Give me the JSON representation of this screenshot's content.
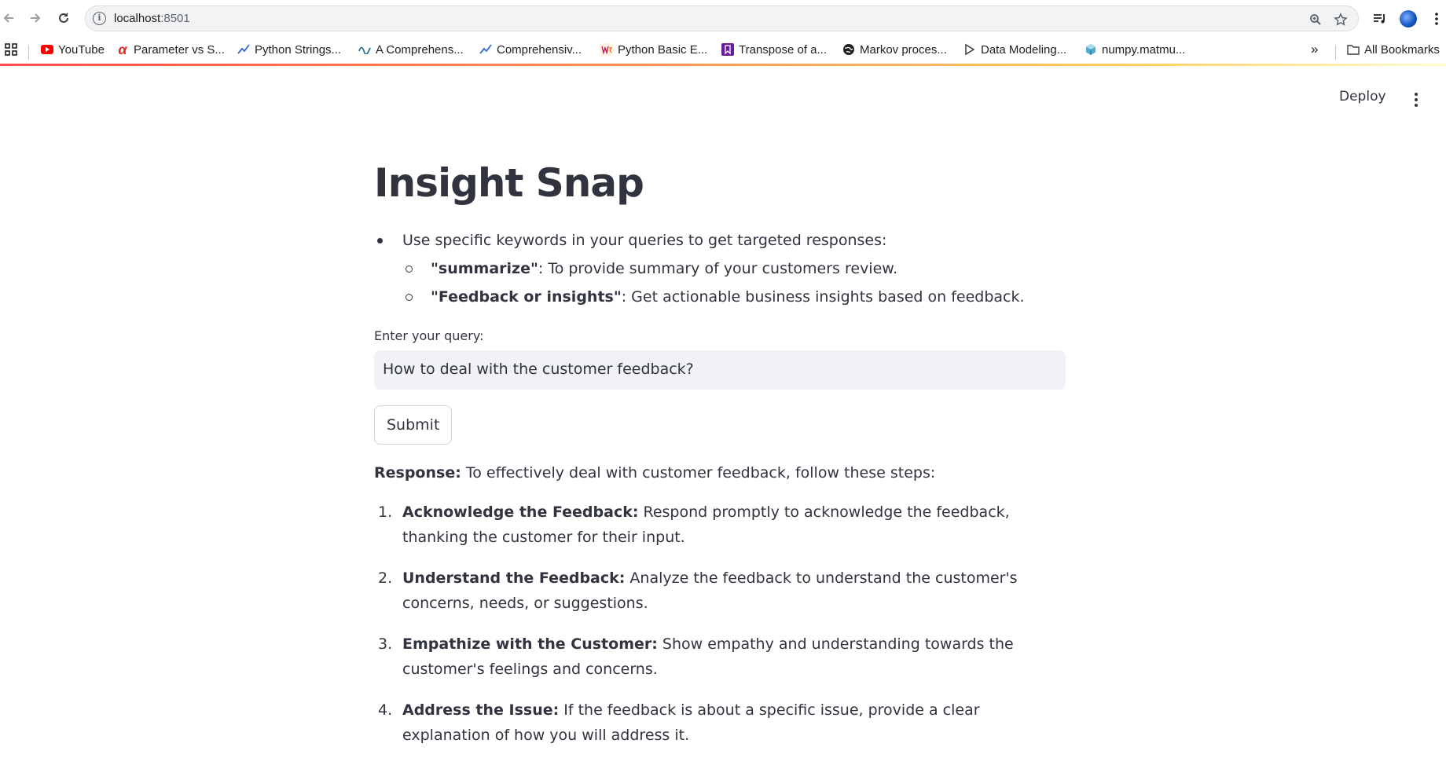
{
  "browser": {
    "url_host": "localhost",
    "url_port": ":8501",
    "bookmarks": [
      {
        "label": "YouTube",
        "icon": "youtube-icon"
      },
      {
        "label": "Parameter vs S...",
        "icon": "alpha-icon"
      },
      {
        "label": "Python Strings...",
        "icon": "trend-icon"
      },
      {
        "label": "A Comprehens...",
        "icon": "wave-icon"
      },
      {
        "label": "Comprehensiv...",
        "icon": "trend-icon"
      },
      {
        "label": "Python Basic E...",
        "icon": "w3-icon"
      },
      {
        "label": "Transpose of a...",
        "icon": "bookmark-purple-icon"
      },
      {
        "label": "Markov proces...",
        "icon": "globe-icon"
      },
      {
        "label": "Data Modeling...",
        "icon": "play-outline-icon"
      },
      {
        "label": "numpy.matmu...",
        "icon": "numpy-icon"
      }
    ],
    "overflow": "»",
    "all_bookmarks": "All Bookmarks"
  },
  "app": {
    "deploy_label": "Deploy",
    "title": "Insight Snap",
    "instructions": {
      "intro": "Use specific keywords in your queries to get targeted responses:",
      "items": [
        {
          "keyword": "\"summarize\"",
          "text": ": To provide summary of your customers review."
        },
        {
          "keyword": "\"Feedback or insights\"",
          "text": ": Get actionable business insights based on feedback."
        }
      ]
    },
    "query_label": "Enter your query:",
    "query_value": "How to deal with the customer feedback?",
    "submit_label": "Submit",
    "response": {
      "label": "Response:",
      "intro": " To effectively deal with customer feedback, follow these steps:",
      "steps": [
        {
          "num": "1.",
          "title": "Acknowledge the Feedback:",
          "text": " Respond promptly to acknowledge the feedback, thanking the customer for their input."
        },
        {
          "num": "2.",
          "title": "Understand the Feedback:",
          "text": " Analyze the feedback to understand the customer's concerns, needs, or suggestions."
        },
        {
          "num": "3.",
          "title": "Empathize with the Customer:",
          "text": " Show empathy and understanding towards the customer's feelings and concerns."
        },
        {
          "num": "4.",
          "title": "Address the Issue:",
          "text": " If the feedback is about a specific issue, provide a clear explanation of how you will address it."
        }
      ]
    }
  }
}
